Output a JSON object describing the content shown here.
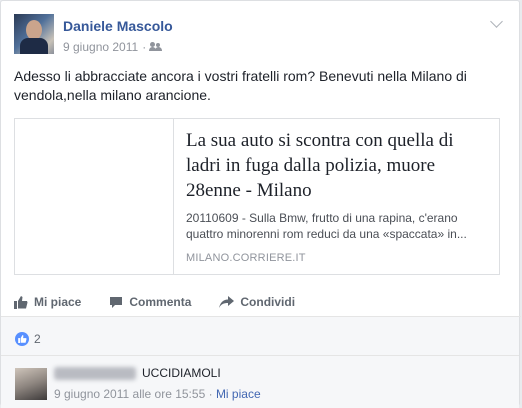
{
  "post": {
    "author": "Daniele Mascolo",
    "date": "9 giugno 2011",
    "dot": "·",
    "text": "Adesso li abbracciate ancora i vostri fratelli rom? Benevuti nella Milano di vendola,nella milano arancione."
  },
  "link_preview": {
    "title": "La sua auto si scontra con quella di ladri in fuga dalla polizia, muore 28enne - Milano",
    "description": "20110609 - Sulla Bmw, frutto di una rapina, c'erano quattro minorenni rom reduci da una «spaccata» in...",
    "domain": "MILANO.CORRIERE.IT"
  },
  "actions": {
    "like": "Mi piace",
    "comment": "Commenta",
    "share": "Condividi"
  },
  "reactions": {
    "count": "2"
  },
  "comment": {
    "text": "UCCIDIAMOLI",
    "timestamp": "9 giugno 2011 alle ore 15:55",
    "dot": "·",
    "like": "Mi piace"
  },
  "icons": {
    "audience": "friends-icon",
    "like": "thumbs-up-icon",
    "comment": "speech-bubble-icon",
    "share": "share-arrow-icon",
    "options": "chevron-down-icon"
  },
  "colors": {
    "link_blue": "#365899",
    "like_badge": "#5890ff",
    "meta_gray": "#90949c"
  }
}
